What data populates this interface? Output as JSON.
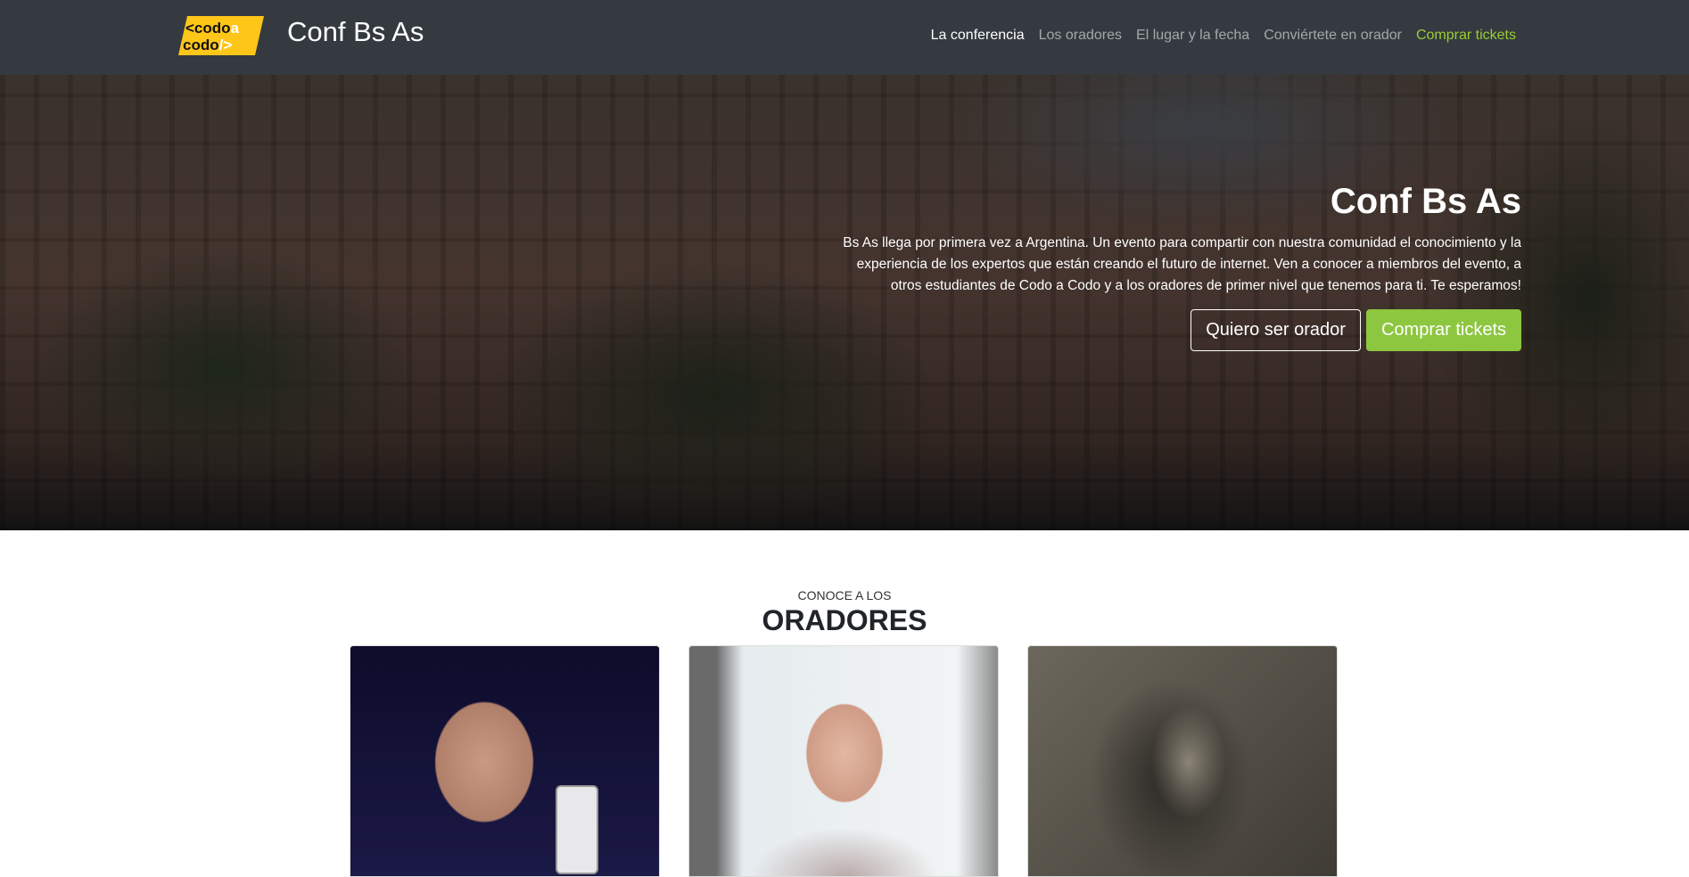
{
  "nav": {
    "logo_text": "<codoa codo/>",
    "brand": "Conf Bs As",
    "links": [
      {
        "label": "La conferencia"
      },
      {
        "label": "Los oradores"
      },
      {
        "label": "El lugar y la fecha"
      },
      {
        "label": "Conviértete en orador"
      },
      {
        "label": "Comprar tickets"
      }
    ]
  },
  "hero": {
    "title": "Conf Bs As",
    "text": "Bs As llega por primera vez a Argentina. Un evento para compartir con nuestra comunidad el conocimiento y la experiencia de los expertos que están creando el futuro de internet. Ven a conocer a miembros del evento, a otros estudiantes de Codo a Codo y a los oradores de primer nivel que tenemos para ti. Te esperamos!",
    "btn_speaker": "Quiero ser orador",
    "btn_tickets": "Comprar tickets"
  },
  "speakers": {
    "subtitle": "CONOCE A LOS",
    "title": "ORADORES"
  },
  "colors": {
    "accent": "#8dc63f",
    "nav_bg": "#343a40",
    "logo": "#ffc61a"
  }
}
